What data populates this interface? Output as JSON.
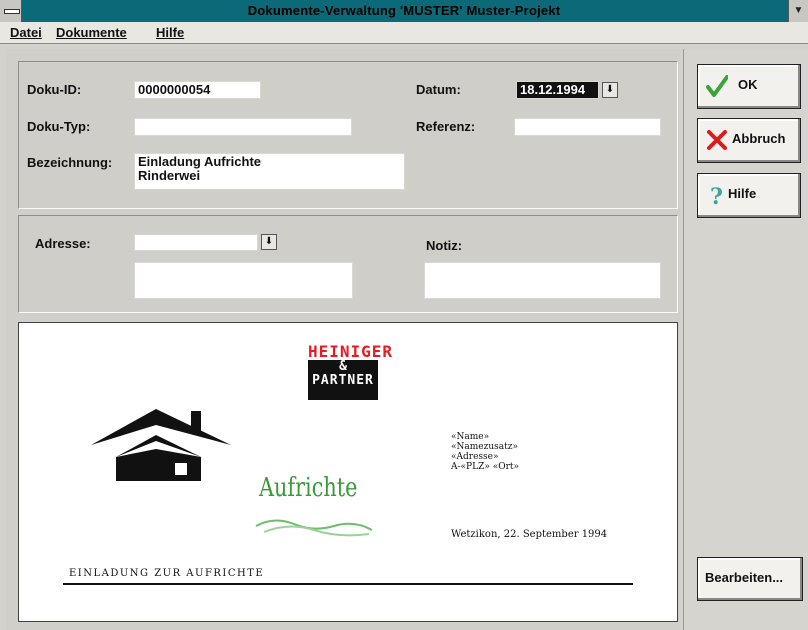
{
  "window": {
    "title": "Dokumente-Verwaltung  'MUSTER'  Muster-Projekt",
    "scroll_indicator": "▼"
  },
  "menu": {
    "datei": "Datei",
    "dokumente": "Dokumente",
    "hilfe": "Hilfe"
  },
  "form": {
    "doku_id_label": "Doku-ID:",
    "doku_id_value": "0000000054",
    "datum_label": "Datum:",
    "datum_value": "18.12.1994",
    "doku_typ_label": "Doku-Typ:",
    "doku_typ_value": "",
    "referenz_label": "Referenz:",
    "referenz_value": "",
    "bezeichnung_label": "Bezeichnung:",
    "bezeichnung_line1": "Einladung Aufrichte",
    "bezeichnung_line2": "Rinderwei",
    "adresse_label": "Adresse:",
    "adresse_value": "",
    "adresse_detail": "",
    "notiz_label": "Notiz:",
    "notiz_value": "",
    "dropdown_icon": "down-arrow-icon"
  },
  "preview": {
    "logo_line1": "HEINIGER",
    "logo_line2": "&",
    "logo_line3": "PARTNER",
    "address_lines": [
      "«Name»",
      "«Namezusatz»",
      "«Adresse»",
      "A-«PLZ» «Ort»"
    ],
    "place_date": "Wetzikon, 22. September 1994",
    "aufrichte": "Aufrichte",
    "heading": "EINLADUNG ZUR AUFRICHTE"
  },
  "buttons": {
    "ok": "OK",
    "abbruch": "Abbruch",
    "hilfe": "Hilfe",
    "bearbeiten": "Bearbeiten..."
  },
  "colors": {
    "titlebar": "#0c6a78",
    "logo_red": "#e61b23",
    "ok_green": "#3aa33a",
    "abbruch_red": "#d91c1c",
    "hilfe_teal": "#3aa3a0",
    "aufrichte_green": "#3a9a3a"
  }
}
